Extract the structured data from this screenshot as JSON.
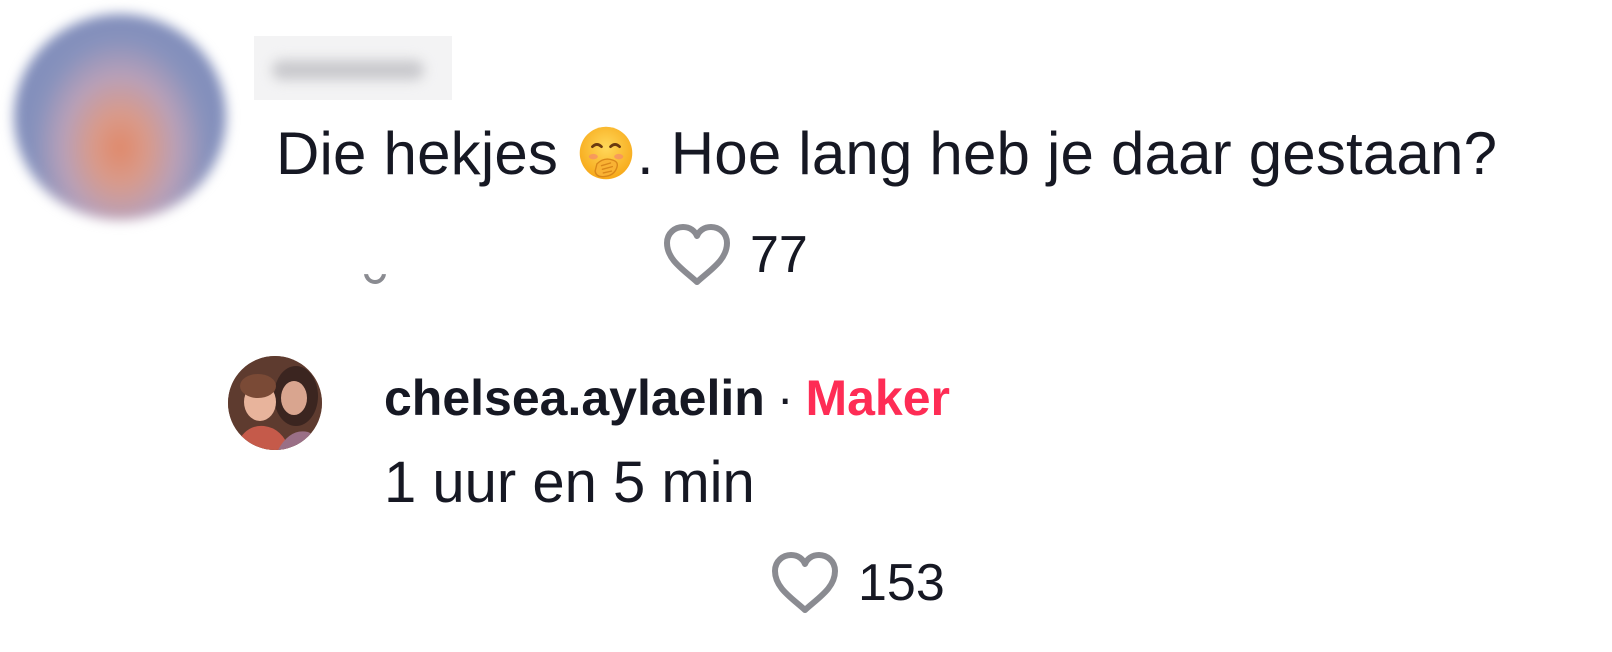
{
  "comment": {
    "text_before_emoji": "Die hekjes ",
    "emoji_name": "face-with-hand-over-mouth-emoji",
    "text_after_emoji": ". Hoe lang heb je daar gestaan?",
    "likes": "77"
  },
  "reply": {
    "username": "chelsea.aylaelin",
    "separator": "·",
    "badge": "Maker",
    "text": "1 uur en 5 min",
    "likes": "153"
  },
  "icons": {
    "like": "heart-outline-icon"
  },
  "colors": {
    "text": "#161823",
    "maker_badge": "#fe2c55",
    "icon_grey": "#8a8b91",
    "background": "#ffffff"
  }
}
